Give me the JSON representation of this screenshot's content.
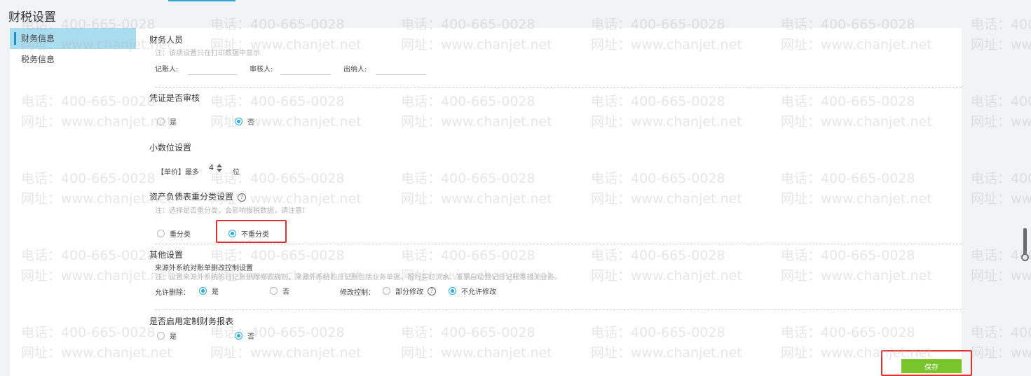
{
  "page": {
    "title": "财税设置"
  },
  "sidebar": {
    "items": [
      {
        "label": "财务信息",
        "active": true
      },
      {
        "label": "税务信息",
        "active": false
      }
    ]
  },
  "finance_staff": {
    "title": "财务人员",
    "note": "注：该项设置只在打印数据中显示",
    "fields": [
      {
        "label": "记账人:",
        "value": ""
      },
      {
        "label": "审核人:",
        "value": ""
      },
      {
        "label": "出纳人:",
        "value": ""
      }
    ]
  },
  "voucher_review": {
    "title": "凭证是否审核",
    "options": [
      {
        "label": "是",
        "selected": false
      },
      {
        "label": "否",
        "selected": true
      }
    ]
  },
  "decimal": {
    "title": "小数位设置",
    "label": "【单价】最多",
    "value": "4",
    "unit": "位"
  },
  "reclass": {
    "title": "资产负债表重分类设置",
    "help": "?",
    "note": "注：选择是否重分类，会影响报税数据，请注意！",
    "options": [
      {
        "label": "重分类",
        "selected": false
      },
      {
        "label": "不重分类",
        "selected": true
      }
    ]
  },
  "other": {
    "title": "其他设置",
    "subtitle": "来源外系统对账单删改控制设置",
    "note": "注：设置来源外系统的日记账删除修改规则，来源外系统的日记账包括业务单据、银行实时流水、发票自动登记日记账等相关业务。",
    "allow_delete": {
      "label": "允许删除：",
      "options": [
        {
          "label": "是",
          "selected": true
        },
        {
          "label": "否",
          "selected": false
        }
      ]
    },
    "modify_control": {
      "label": "修改控制：",
      "options": [
        {
          "label": "部分修改",
          "selected": false,
          "help": "?"
        },
        {
          "label": "不允许修改",
          "selected": true
        }
      ]
    }
  },
  "custom_reports": {
    "title": "是否启用定制财务报表",
    "options": [
      {
        "label": "是",
        "selected": false
      },
      {
        "label": "否",
        "selected": true
      }
    ]
  },
  "footer": {
    "save_label": "保存"
  },
  "watermark": {
    "phone": "电话：400-665-0028",
    "site": "网址：www.chanjet.net"
  },
  "colors": {
    "accent": "#29a9df",
    "save": "#7ac42b",
    "highlight": "#e03030"
  }
}
